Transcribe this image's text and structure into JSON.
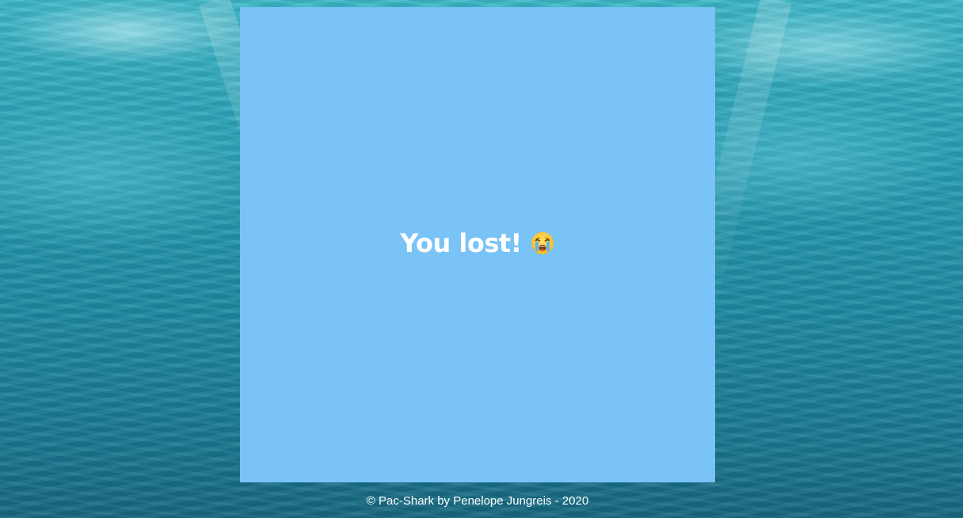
{
  "game": {
    "message": "You lost!",
    "message_icon": "crying-face-icon"
  },
  "footer": {
    "text": "© Pac-Shark by Penelope Jungreis - 2020"
  },
  "colors": {
    "board_background": "#79c3f7",
    "text": "#ffffff",
    "water": "#2aa0b5"
  }
}
